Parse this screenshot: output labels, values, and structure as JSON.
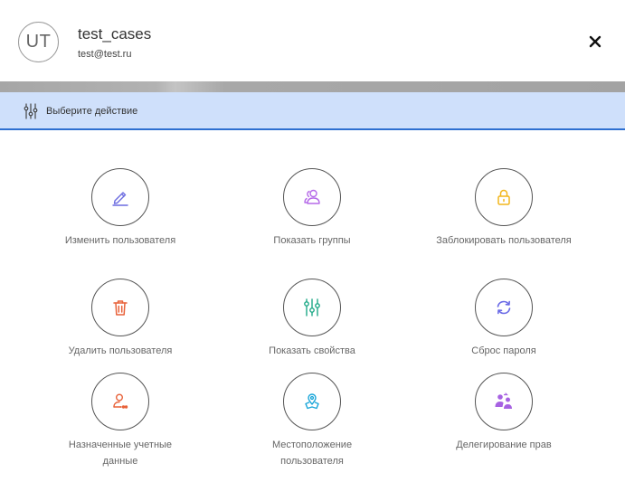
{
  "user": {
    "initials": "UT",
    "name": "test_cases",
    "email": "test@test.ru"
  },
  "action_bar": {
    "label": "Выберите действие",
    "icon": "sliders-icon"
  },
  "actions": [
    {
      "label": "Изменить пользователя",
      "icon": "pencil-icon",
      "color": "#6c6ce0"
    },
    {
      "label": "Показать группы",
      "icon": "users-icon",
      "color": "#b56ae8"
    },
    {
      "label": "Заблокировать пользователя",
      "icon": "lock-icon",
      "color": "#f2b61b"
    },
    {
      "label": "Удалить пользователя",
      "icon": "trash-icon",
      "color": "#e8623a"
    },
    {
      "label": "Показать свойства",
      "icon": "sliders-icon",
      "color": "#1ea987"
    },
    {
      "label": "Сброс пароля",
      "icon": "refresh-icon",
      "color": "#6a6ae6"
    },
    {
      "label": "Назначенные учетные данные",
      "icon": "user-key-icon",
      "color": "#e8623a"
    },
    {
      "label": "Местоположение пользователя",
      "icon": "location-icon",
      "color": "#1aa6d9"
    },
    {
      "label": "Делегирование прав",
      "icon": "delegate-icon",
      "color": "#a762e2"
    }
  ]
}
